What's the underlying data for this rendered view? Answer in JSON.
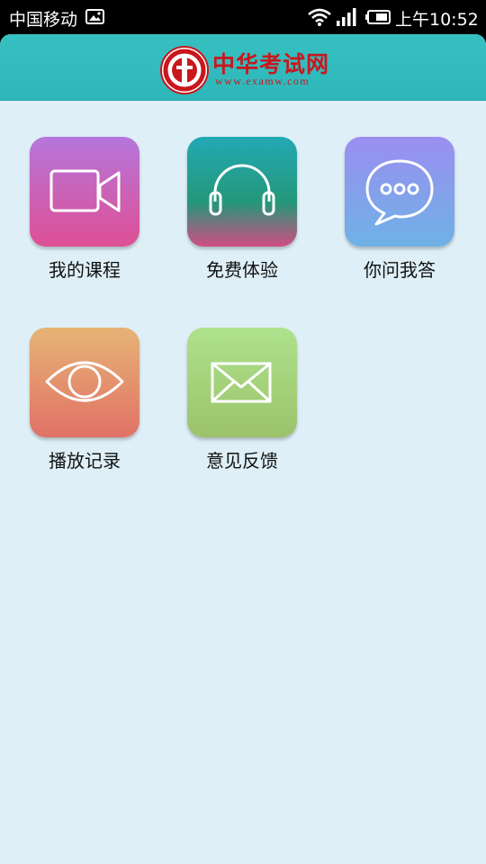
{
  "status_bar": {
    "carrier": "中国移动",
    "time": "上午10:52"
  },
  "header": {
    "logo_title": "中华考试网",
    "logo_url": "www.examw.com",
    "brand_color": "#c8171d",
    "background_color": "#30b9bb"
  },
  "menu": {
    "items": [
      {
        "label": "我的课程",
        "icon": "video-camera-icon"
      },
      {
        "label": "免费体验",
        "icon": "headphones-icon"
      },
      {
        "label": "你问我答",
        "icon": "chat-bubble-icon"
      },
      {
        "label": "播放记录",
        "icon": "eye-icon"
      },
      {
        "label": "意见反馈",
        "icon": "envelope-icon"
      }
    ]
  }
}
